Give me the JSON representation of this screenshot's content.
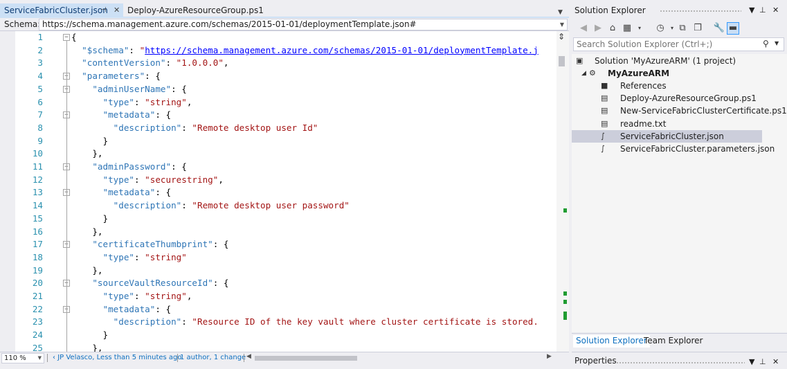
{
  "editor": {
    "tabs": [
      {
        "label": "ServiceFabricCluster.json",
        "active": true
      },
      {
        "label": "Deploy-AzureResourceGroup.ps1",
        "active": false
      }
    ],
    "schema_label": "Schema:",
    "schema_value": "https://schema.management.azure.com/schemas/2015-01-01/deploymentTemplate.json#",
    "lines": [
      {
        "n": "1",
        "text": "{"
      },
      {
        "n": "2",
        "text": "  \"$schema\": \"https://schema.management.azure.com/schemas/2015-01-01/deploymentTemplate.j"
      },
      {
        "n": "3",
        "text": "  \"contentVersion\": \"1.0.0.0\","
      },
      {
        "n": "4",
        "text": "  \"parameters\": {"
      },
      {
        "n": "5",
        "text": "    \"adminUserName\": {"
      },
      {
        "n": "6",
        "text": "      \"type\": \"string\","
      },
      {
        "n": "7",
        "text": "      \"metadata\": {"
      },
      {
        "n": "8",
        "text": "        \"description\": \"Remote desktop user Id\""
      },
      {
        "n": "9",
        "text": "      }"
      },
      {
        "n": "10",
        "text": "    },"
      },
      {
        "n": "11",
        "text": "    \"adminPassword\": {"
      },
      {
        "n": "12",
        "text": "      \"type\": \"securestring\","
      },
      {
        "n": "13",
        "text": "      \"metadata\": {"
      },
      {
        "n": "14",
        "text": "        \"description\": \"Remote desktop user password\""
      },
      {
        "n": "15",
        "text": "      }"
      },
      {
        "n": "16",
        "text": "    },"
      },
      {
        "n": "17",
        "text": "    \"certificateThumbprint\": {"
      },
      {
        "n": "18",
        "text": "      \"type\": \"string\""
      },
      {
        "n": "19",
        "text": "    },"
      },
      {
        "n": "20",
        "text": "    \"sourceVaultResourceId\": {"
      },
      {
        "n": "21",
        "text": "      \"type\": \"string\","
      },
      {
        "n": "22",
        "text": "      \"metadata\": {"
      },
      {
        "n": "23",
        "text": "        \"description\": \"Resource ID of the key vault where cluster certificate is stored."
      },
      {
        "n": "24",
        "text": "      }"
      },
      {
        "n": "25",
        "text": "    },"
      }
    ],
    "fold_lines": [
      "1",
      "4",
      "5",
      "7",
      "11",
      "13",
      "17",
      "20",
      "22"
    ],
    "zoom": "110 %",
    "blame": "JP Velasco, Less than 5 minutes ago",
    "changes": "1 author, 1 change"
  },
  "solution_explorer": {
    "title": "Solution Explorer",
    "search_placeholder": "Search Solution Explorer (Ctrl+;)",
    "items": [
      {
        "label": "Solution 'MyAzureARM' (1 project)",
        "bold": false,
        "indent": 0,
        "icon": "solution-icon"
      },
      {
        "label": "MyAzureARM",
        "bold": true,
        "indent": 1,
        "icon": "project-icon"
      },
      {
        "label": "References",
        "bold": false,
        "indent": 2,
        "icon": "references-icon"
      },
      {
        "label": "Deploy-AzureResourceGroup.ps1",
        "bold": false,
        "indent": 2,
        "icon": "powershell-file-icon"
      },
      {
        "label": "New-ServiceFabricClusterCertificate.ps1",
        "bold": false,
        "indent": 2,
        "icon": "powershell-file-icon"
      },
      {
        "label": "readme.txt",
        "bold": false,
        "indent": 2,
        "icon": "text-file-icon"
      },
      {
        "label": "ServiceFabricCluster.json",
        "bold": false,
        "indent": 2,
        "icon": "json-file-icon",
        "selected": true
      },
      {
        "label": "ServiceFabricCluster.parameters.json",
        "bold": false,
        "indent": 2,
        "icon": "json-file-icon"
      }
    ],
    "bottom_tabs": [
      "Solution Explorer",
      "Team Explorer"
    ],
    "properties_title": "Properties"
  },
  "colors": {
    "keyword": "#2e75b6",
    "string": "#a31515",
    "url": "#0000ff",
    "line_number": "#2b91af",
    "tab_active": "#cce0f5",
    "selection": "#cccedb"
  }
}
